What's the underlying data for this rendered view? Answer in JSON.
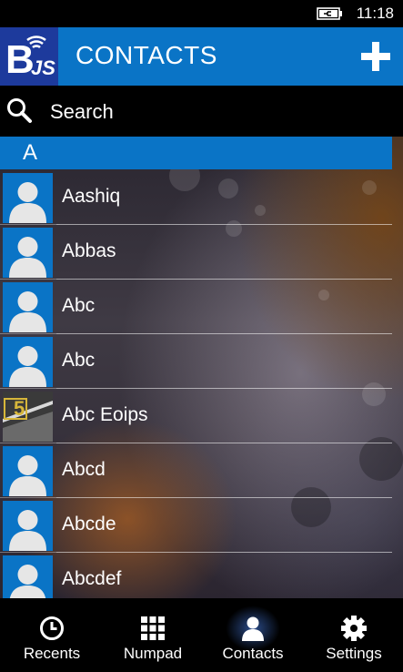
{
  "status_bar": {
    "time": "11:18",
    "battery_icon": "battery-charging-icon"
  },
  "header": {
    "logo_icon": "app-logo-icon",
    "title": "CONTACTS",
    "add_icon": "plus-icon"
  },
  "search": {
    "icon": "search-icon",
    "placeholder": "Search",
    "value": ""
  },
  "contacts": {
    "group_letter": "A",
    "items": [
      {
        "name": "Aashiq",
        "avatar": "default-person-icon"
      },
      {
        "name": "Abbas",
        "avatar": "default-person-icon"
      },
      {
        "name": "Abc",
        "avatar": "default-person-icon"
      },
      {
        "name": "Abc",
        "avatar": "default-person-icon"
      },
      {
        "name": "Abc Eoips",
        "avatar": "photo-avatar"
      },
      {
        "name": "Abcd",
        "avatar": "default-person-icon"
      },
      {
        "name": "Abcde",
        "avatar": "default-person-icon"
      },
      {
        "name": "Abcdef",
        "avatar": "default-person-icon"
      }
    ]
  },
  "bottom_nav": {
    "active": "Contacts",
    "items": [
      {
        "label": "Recents",
        "icon": "clock-icon"
      },
      {
        "label": "Numpad",
        "icon": "grid-icon"
      },
      {
        "label": "Contacts",
        "icon": "person-icon"
      },
      {
        "label": "Settings",
        "icon": "gear-icon"
      }
    ]
  },
  "colors": {
    "accent": "#0a74c6",
    "logo_bg": "#1d3a9c",
    "background": "#000000",
    "text": "#ffffff"
  }
}
